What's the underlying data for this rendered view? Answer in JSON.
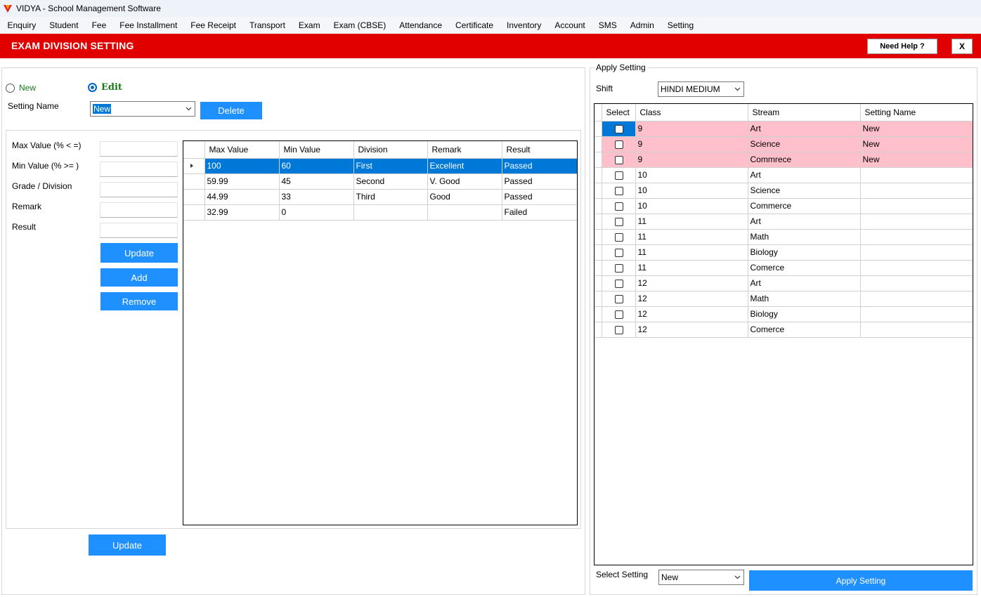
{
  "window": {
    "title": "VIDYA - School Management Software"
  },
  "menu": [
    "Enquiry",
    "Student",
    "Fee",
    "Fee Installment",
    "Fee Receipt",
    "Transport",
    "Exam",
    "Exam (CBSE)",
    "Attendance",
    "Certificate",
    "Inventory",
    "Account",
    "SMS",
    "Admin",
    "Setting"
  ],
  "header": {
    "title": "EXAM DIVISION SETTING",
    "help_label": "Need Help ?",
    "close_label": "X",
    "accent": "#e00000"
  },
  "mode": {
    "new_label": "New",
    "edit_label": "Edit",
    "selected": "Edit"
  },
  "setting_name": {
    "label": "Setting Name",
    "value": "New",
    "delete_label": "Delete"
  },
  "form": {
    "max_label": "Max Value   (% < =)",
    "min_label": "Min Value    (% >= )",
    "grade_label": "Grade / Division",
    "remark_label": "Remark",
    "result_label": "Result",
    "update_label": "Update",
    "add_label": "Add",
    "remove_label": "Remove"
  },
  "division_grid": {
    "columns": [
      "Max Value",
      "Min Value",
      "Division",
      "Remark",
      "Result"
    ],
    "rows": [
      [
        "100",
        "60",
        "First",
        "Excellent",
        "Passed"
      ],
      [
        "59.99",
        "45",
        "Second",
        "V. Good",
        "Passed"
      ],
      [
        "44.99",
        "33",
        "Third",
        "Good",
        "Passed"
      ],
      [
        "32.99",
        "0",
        "",
        "",
        "Failed"
      ]
    ]
  },
  "bottom_update_label": "Update",
  "apply": {
    "group_title": "Apply Setting",
    "shift_label": "Shift",
    "shift_value": "HINDI MEDIUM",
    "columns": [
      "Select",
      "Class",
      "Stream",
      "Setting Name"
    ],
    "rows": [
      [
        "9",
        "Art",
        "New"
      ],
      [
        "9",
        "Science",
        "New"
      ],
      [
        "9",
        "Commrece",
        "New"
      ],
      [
        "10",
        "Art",
        ""
      ],
      [
        "10",
        "Science",
        ""
      ],
      [
        "10",
        "Commerce",
        ""
      ],
      [
        "11",
        "Art",
        ""
      ],
      [
        "11",
        "Math",
        ""
      ],
      [
        "11",
        "Biology",
        ""
      ],
      [
        "11",
        "Comerce",
        ""
      ],
      [
        "12",
        "Art",
        ""
      ],
      [
        "12",
        "Math",
        ""
      ],
      [
        "12",
        "Biology",
        ""
      ],
      [
        "12",
        "Comerce",
        ""
      ]
    ],
    "select_setting_label": "Select Setting",
    "select_setting_value": "New",
    "apply_label": "Apply Setting"
  }
}
